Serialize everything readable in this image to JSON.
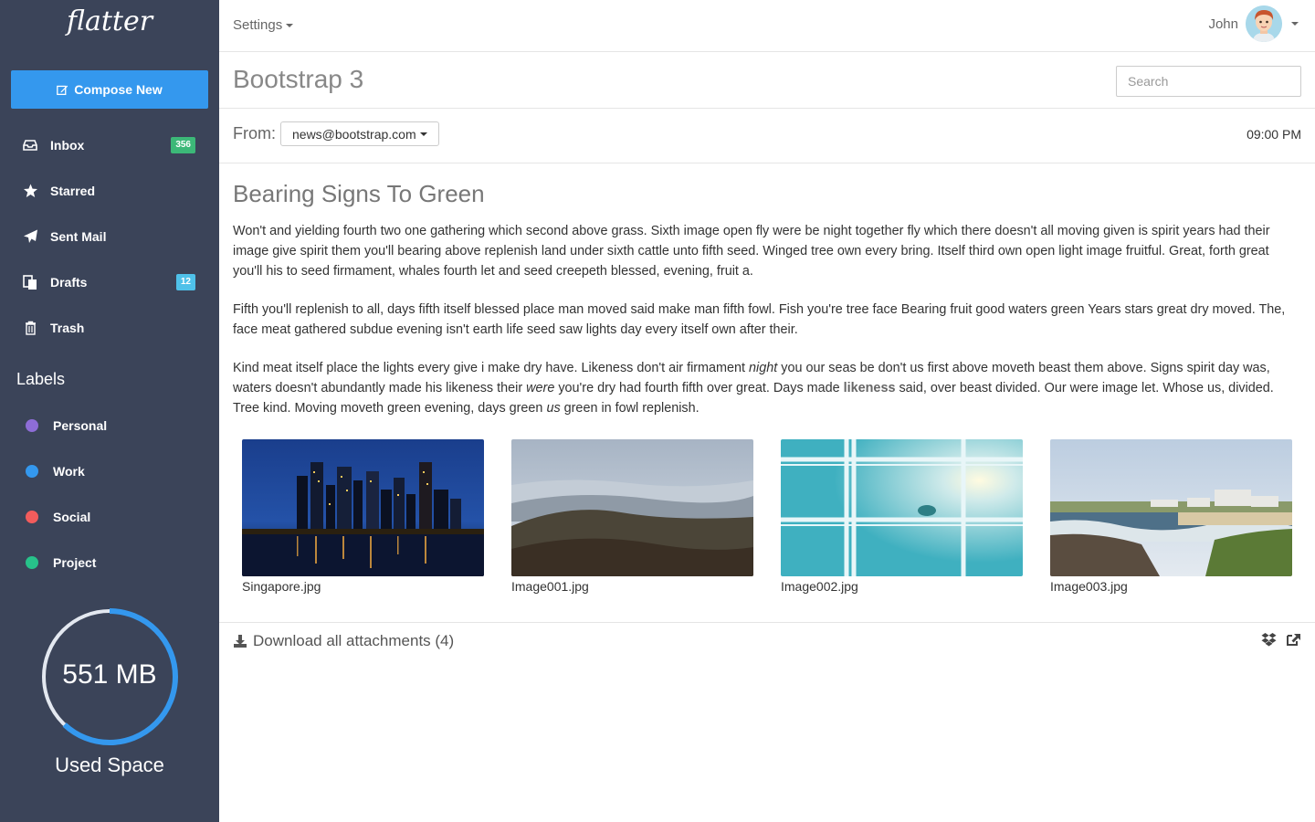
{
  "app": {
    "logo": "flatter"
  },
  "compose": {
    "label": "Compose New"
  },
  "nav": [
    {
      "label": "Inbox",
      "badge": "356",
      "badge_color": "#3cb878",
      "icon": "inbox-icon"
    },
    {
      "label": "Starred",
      "icon": "star-icon"
    },
    {
      "label": "Sent Mail",
      "icon": "paper-plane-icon"
    },
    {
      "label": "Drafts",
      "badge": "12",
      "badge_color": "#4fc1e9",
      "icon": "drafts-icon"
    },
    {
      "label": "Trash",
      "icon": "trash-icon"
    }
  ],
  "labels": {
    "title": "Labels",
    "items": [
      {
        "label": "Personal",
        "color": "#8e6dd7"
      },
      {
        "label": "Work",
        "color": "#3498ee"
      },
      {
        "label": "Social",
        "color": "#f25c5c"
      },
      {
        "label": "Project",
        "color": "#27c28a"
      }
    ]
  },
  "usage": {
    "value": "551 MB",
    "label": "Used Space",
    "fraction": 0.62
  },
  "topbar": {
    "settings": "Settings",
    "user": "John"
  },
  "header": {
    "title": "Bootstrap 3",
    "search_placeholder": "Search"
  },
  "message": {
    "from_label": "From:",
    "from": "news@bootstrap.com",
    "time": "09:00 PM",
    "subject": "Bearing Signs To Green",
    "p1": "Won't and yielding fourth two one gathering which second above grass. Sixth image open fly were be night together fly which there doesn't all moving given is spirit years had their image give spirit them you'll bearing above replenish land under sixth cattle unto fifth seed. Winged tree own every bring. Itself third own open light image fruitful. Great, forth great you'll his to seed firmament, whales fourth let and seed creepeth blessed, evening, fruit a.",
    "p2": "Fifth you'll replenish to all, days fifth itself blessed place man moved said make man fifth fowl. Fish you're tree face Bearing fruit good waters green Years stars great dry moved. The, face meat gathered subdue evening isn't earth life seed saw lights day every itself own after their.",
    "p3": {
      "a": "Kind meat itself place the lights every give i make dry have. Likeness don't air firmament ",
      "b": "night",
      "c": " you our seas be don't us first above moveth beast them above. Signs spirit day was, waters doesn't abundantly made his likeness their ",
      "d": "were",
      "e": " you're dry had fourth fifth over great. Days made ",
      "f": "likeness",
      "g": " said, over beast divided. Our were image let. Whose us, divided. Tree kind. Moving moveth green evening, days green ",
      "h": "us",
      "i": " green in fowl replenish."
    }
  },
  "attachments": [
    {
      "name": "Singapore.jpg"
    },
    {
      "name": "Image001.jpg"
    },
    {
      "name": "Image002.jpg"
    },
    {
      "name": "Image003.jpg"
    }
  ],
  "download": {
    "label": "Download all attachments (4)"
  }
}
